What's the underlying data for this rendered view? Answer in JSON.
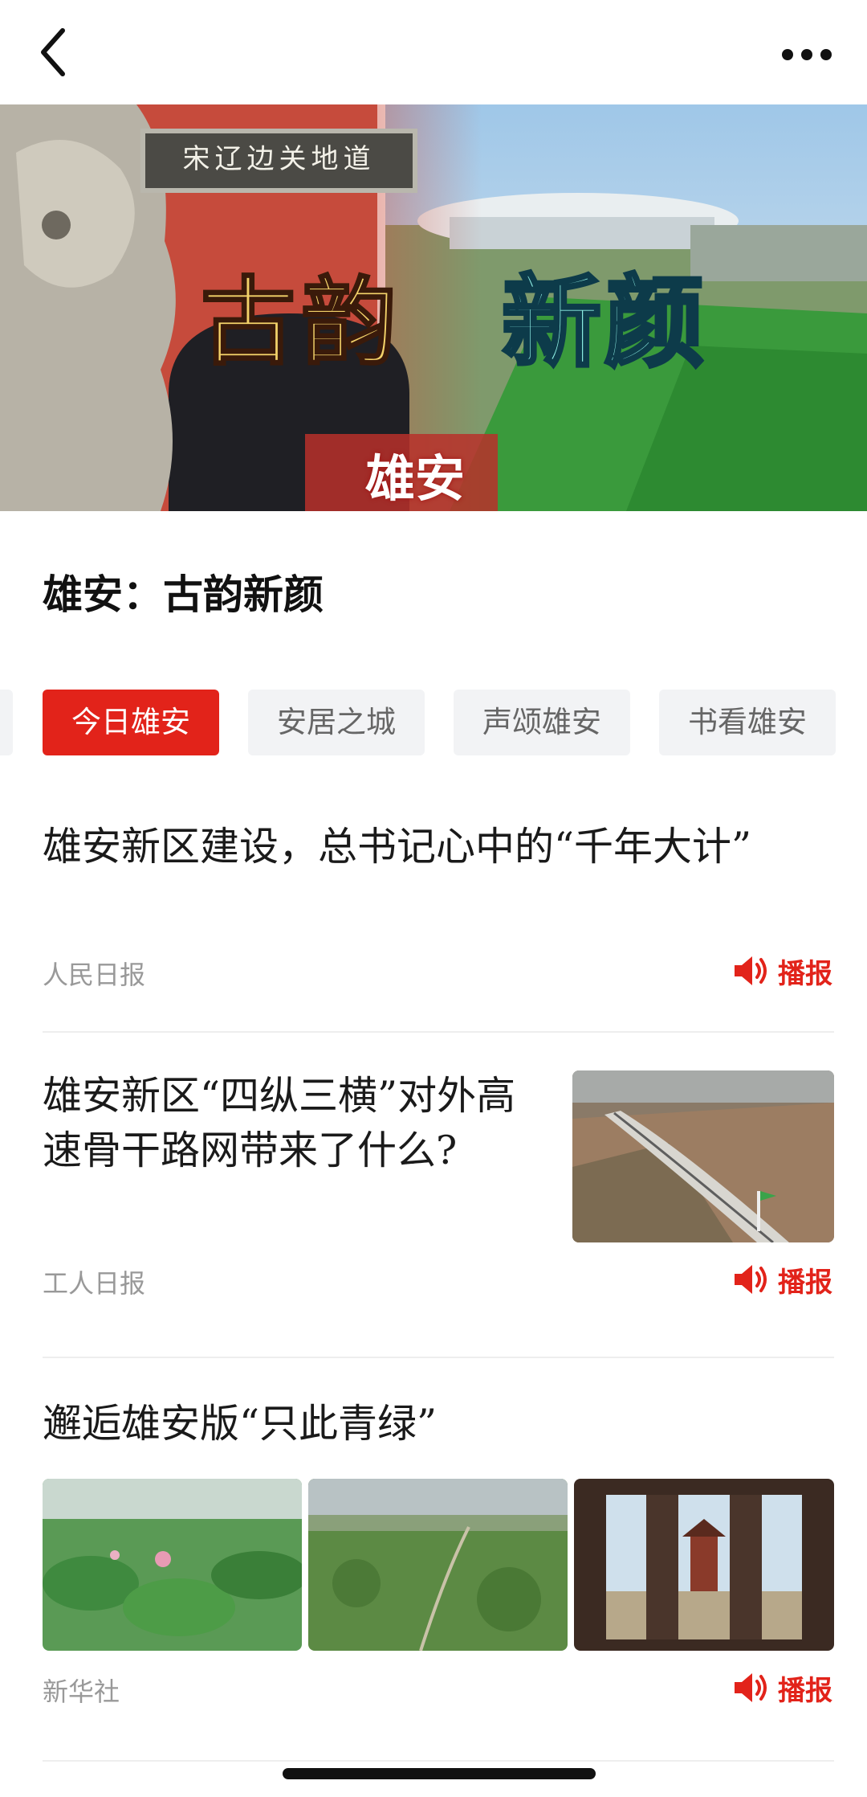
{
  "nav": {
    "back_icon": "chevron-left-icon",
    "more_icon": "more-horizontal-icon"
  },
  "banner": {
    "plaque_text": "宋辽边关地道",
    "title_left": "古韵",
    "title_right": "新颜",
    "tag": "雄安"
  },
  "page_title": "雄安：古韵新颜",
  "tabs": [
    {
      "label": "今日雄安",
      "active": true
    },
    {
      "label": "安居之城",
      "active": false
    },
    {
      "label": "声颂雄安",
      "active": false
    },
    {
      "label": "书看雄安",
      "active": false
    }
  ],
  "articles": [
    {
      "title": "雄安新区建设，总书记心中的“千年大计”",
      "source": "人民日报",
      "play_label": "播报"
    },
    {
      "title": "雄安新区“四纵三横”对外高速骨干路网带来了什么?",
      "source": "工人日报",
      "play_label": "播报"
    },
    {
      "title": "邂逅雄安版“只此青绿”",
      "source": "新华社",
      "play_label": "播报"
    }
  ],
  "colors": {
    "accent": "#e2231a",
    "tab_inactive_bg": "#f2f3f5",
    "source_text": "#999999"
  }
}
